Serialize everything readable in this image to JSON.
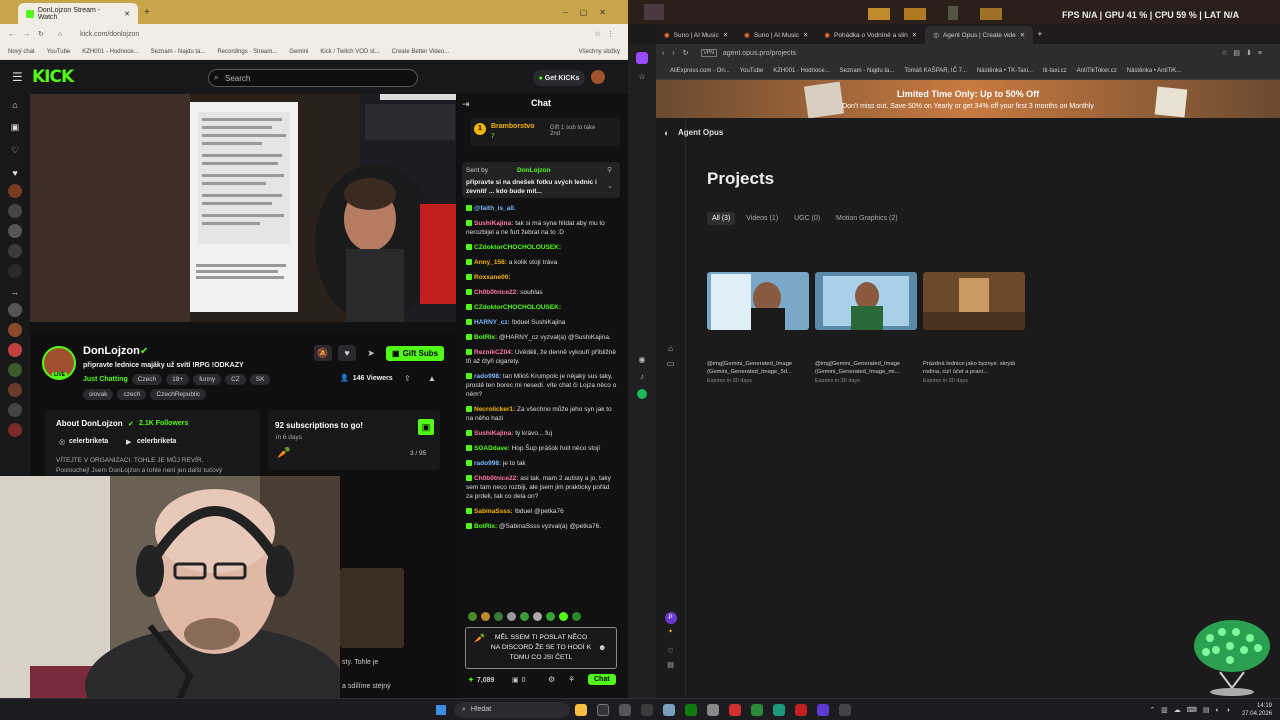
{
  "left_browser": {
    "tabs": [
      "DonLojzon Stream - Watch"
    ],
    "url": "kick.com/donlojzon",
    "bookmarks": [
      "Nový chat",
      "YouTube",
      "KZH001 - Hodnoce...",
      "Seznam - Najdu ta...",
      "Recordings · Stream...",
      "Gemini",
      "Kick / Twitch VOD st...",
      "Create Better Video...",
      "Všechny složky"
    ]
  },
  "kick": {
    "logo": "KICK",
    "search_placeholder": "Search",
    "get_kicks": "Get KICKs",
    "chat_header": "Chat",
    "streamer": {
      "name": "DonLojzon",
      "title": "připravte lednice majáky už svítí !RPG !ODKAZY",
      "category": "Just Chatting",
      "tags": [
        "Czech",
        "18+",
        "funny",
        "CZ",
        "SK"
      ],
      "tags2": [
        "slovak",
        "czech",
        "CzechRepublic"
      ],
      "viewers": "146 Viewers",
      "gift_subs": "Gift Subs",
      "live": "LIVE"
    },
    "about": {
      "title": "About DonLojzon",
      "followers": "2.1K Followers",
      "social1": "celerbriketa",
      "social2": "celerbriketa",
      "text1": "VÍTEJTE V ORGANIZACI. TOHLE JE MŮJ REVÍR.",
      "text2": "Poslouchej! Jsem DonLojzon a tohle není jen další tučový"
    },
    "goal": {
      "title": "92 subscriptions to go!",
      "sub": "in 6 days",
      "count": "3 / 95"
    },
    "chat": {
      "top_user": "Bramborstvo",
      "top_user_count": "7",
      "gift_text": "Gift 1 sub to take 2nd",
      "pinned_by": "Sent by",
      "pinned_user": "DonLojzon",
      "pinned_text": "připravte si na dnešek fotku svých lednic i zevnitř ... kdo bude mít...",
      "messages": [
        {
          "user": "@faith_is_all.",
          "text": "",
          "cls": "u4"
        },
        {
          "user": "SushiKajina:",
          "text": "tak si má syna hlídat aby mu to nerozbijel a ne furt žebrat na to :D",
          "cls": "u1"
        },
        {
          "user": "CZdoktorCHOCHOLOUSEK:",
          "text": "",
          "cls": "u2"
        },
        {
          "user": "Anny_156:",
          "text": "a kolik stojí tráva",
          "cls": "u3"
        },
        {
          "user": "Roxxane00:",
          "text": "",
          "cls": "u3"
        },
        {
          "user": "Ch0b0tnice22:",
          "text": "souhlas",
          "cls": "u1"
        },
        {
          "user": "CZdoktorCHOCHOLOUSEK:",
          "text": "",
          "cls": "u2"
        },
        {
          "user": "HARNY_cz:",
          "text": "!bduel SushiKajina",
          "cls": "u4"
        },
        {
          "user": "BotRix:",
          "text": "@HARNY_cz vyzval(a) @SushiKajina.",
          "cls": "u2"
        },
        {
          "user": "ReznikCZ04:",
          "text": "Uvěděli, že denně vykouří příbližně tři až čtyři cigarety.",
          "cls": "u1"
        },
        {
          "user": "rado998:",
          "text": "tan Miloš Krumpolc je nějaký sus taky, prostě ten borec mi nesedí. víte chat či Lojza něco o něm?",
          "cls": "u4"
        },
        {
          "user": "Necrolicker1:",
          "text": "Za všechno může jeho syn jak to na něho hazi",
          "cls": "u3"
        },
        {
          "user": "SushiKajina:",
          "text": "ty krávo... fuj",
          "cls": "u1"
        },
        {
          "user": "SOADdave:",
          "text": "Hop Šup prášok hoit něco stojí",
          "cls": "u2"
        },
        {
          "user": "rado998:",
          "text": "je to tak",
          "cls": "u4"
        },
        {
          "user": "Ch0b0tnice22:",
          "text": "asi tak, mam 2 autisty a jo, taky sem tam neco rozbiji, ale jsem jim prakticky pořád za prdeli, tak co dela on?",
          "cls": "u1"
        },
        {
          "user": "SabinaSsss:",
          "text": "!bduel @petka76",
          "cls": "u3"
        },
        {
          "user": "BotRix:",
          "text": "@SabinaSsss vyzval(a) @petka76.",
          "cls": "u2"
        }
      ],
      "input_text": "MĚL SSEM TI POSLAT NĚCO NA DISCORD ŽE SE TO HODÍ K TOMU CO JSI ČETL",
      "points": "7,089",
      "zero": "0",
      "send": "Chat"
    }
  },
  "right_browser": {
    "hud": "FPS N/A | GPU 41 % | CPU 59 % | LAT N/A",
    "tabs": [
      "Suno | AI Music",
      "Suno | AI Music",
      "Pohádka o Vodníně a slin",
      "Agent Opus | Create vide"
    ],
    "url": "agent.opus.pro/projects",
    "bookmarks": [
      "AliExpress.com - On...",
      "YouTube",
      "KZH001 - Hodnoce...",
      "Seznam - Najdu ta...",
      "Tomáš KAŠPAR, IČ 7...",
      "Nástěnka • TK-Taxi...",
      "tk-taxi.cz",
      "AntiTikToker.cz",
      "Nástěnka • AntiTiK..."
    ],
    "banner_title": "Limited Time Only: Up to 50% Off",
    "banner_sub": "Don't miss out. Save 50% on Yearly or get 34% off your first 3 months on Monthly",
    "brand": "Agent Opus",
    "page_title": "Projects",
    "filters": [
      "All (3)",
      "Videos (1)",
      "UGC (0)",
      "Motion Graphics (2)"
    ],
    "projects": [
      {
        "title": "@img[Gemini_Generated_Image (Gemini_Generated_Image_5d...",
        "expires": "Expires in 30 days"
      },
      {
        "title": "@img[Gemini_Generated_Image (Gemini_Generated_Image_mi...",
        "expires": "Expires in 30 days"
      },
      {
        "title": "Prázdná lednice jako byznys: skrytá rodina, cizí účet a praní...",
        "expires": "Expires in 30 days"
      }
    ]
  },
  "taskbar": {
    "search": "Hledat",
    "time": "14:19",
    "date": "27.04.2026"
  },
  "overlay_text": {
    "bottom1": "sty. Tohle je",
    "bottom2": "a sdílíme stejný"
  },
  "colors": {
    "kick_green": "#53fc18",
    "banner_orange": "#ff7a2a"
  }
}
